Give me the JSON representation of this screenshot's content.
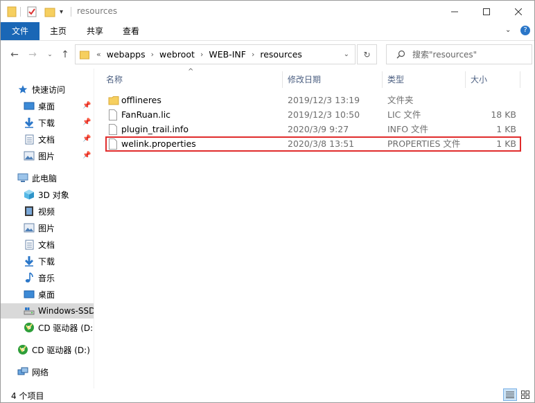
{
  "window": {
    "title": "resources",
    "accent": "#1a67b6"
  },
  "ribbon": {
    "tabs": [
      "文件",
      "主页",
      "共享",
      "查看"
    ]
  },
  "address": {
    "overflow": "«",
    "crumbs": [
      "webapps",
      "webroot",
      "WEB-INF",
      "resources"
    ]
  },
  "search": {
    "placeholder": "搜索\"resources\""
  },
  "sidebar": {
    "quick_access": "快速访问",
    "quick_items": [
      "桌面",
      "下载",
      "文档",
      "图片"
    ],
    "this_pc": "此电脑",
    "pc_items": [
      "3D 对象",
      "视频",
      "图片",
      "文档",
      "下载",
      "音乐",
      "桌面",
      "Windows-SSD",
      "CD 驱动器 (D:"
    ],
    "cd_drive": "CD 驱动器 (D:)",
    "network": "网络"
  },
  "columns": {
    "name": "名称",
    "modified": "修改日期",
    "type": "类型",
    "size": "大小"
  },
  "files": [
    {
      "name": "offlineres",
      "modified": "2019/12/3 13:19",
      "type": "文件夹",
      "size": "",
      "kind": "folder"
    },
    {
      "name": "FanRuan.lic",
      "modified": "2019/12/3 10:50",
      "type": "LIC 文件",
      "size": "18 KB",
      "kind": "file"
    },
    {
      "name": "plugin_trail.info",
      "modified": "2020/3/9 9:27",
      "type": "INFO 文件",
      "size": "1 KB",
      "kind": "file"
    },
    {
      "name": "welink.properties",
      "modified": "2020/3/8 13:51",
      "type": "PROPERTIES 文件",
      "size": "1 KB",
      "kind": "file"
    }
  ],
  "status": {
    "count": "4 个项目"
  }
}
